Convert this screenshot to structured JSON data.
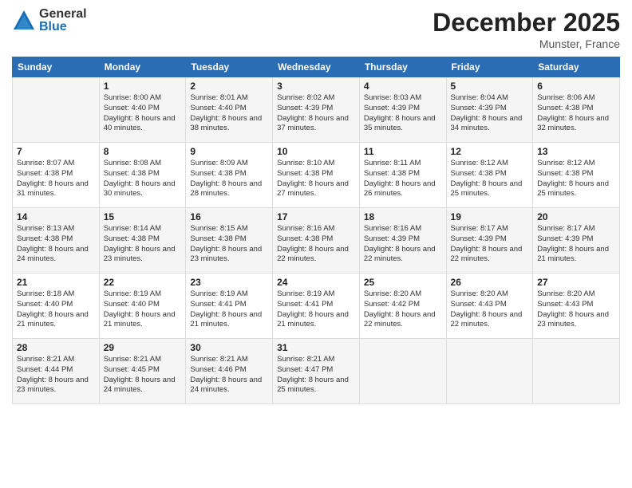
{
  "header": {
    "logo_general": "General",
    "logo_blue": "Blue",
    "month_title": "December 2025",
    "location": "Munster, France"
  },
  "weekdays": [
    "Sunday",
    "Monday",
    "Tuesday",
    "Wednesday",
    "Thursday",
    "Friday",
    "Saturday"
  ],
  "weeks": [
    [
      {
        "day": "",
        "sunrise": "",
        "sunset": "",
        "daylight": ""
      },
      {
        "day": "1",
        "sunrise": "Sunrise: 8:00 AM",
        "sunset": "Sunset: 4:40 PM",
        "daylight": "Daylight: 8 hours and 40 minutes."
      },
      {
        "day": "2",
        "sunrise": "Sunrise: 8:01 AM",
        "sunset": "Sunset: 4:40 PM",
        "daylight": "Daylight: 8 hours and 38 minutes."
      },
      {
        "day": "3",
        "sunrise": "Sunrise: 8:02 AM",
        "sunset": "Sunset: 4:39 PM",
        "daylight": "Daylight: 8 hours and 37 minutes."
      },
      {
        "day": "4",
        "sunrise": "Sunrise: 8:03 AM",
        "sunset": "Sunset: 4:39 PM",
        "daylight": "Daylight: 8 hours and 35 minutes."
      },
      {
        "day": "5",
        "sunrise": "Sunrise: 8:04 AM",
        "sunset": "Sunset: 4:39 PM",
        "daylight": "Daylight: 8 hours and 34 minutes."
      },
      {
        "day": "6",
        "sunrise": "Sunrise: 8:06 AM",
        "sunset": "Sunset: 4:38 PM",
        "daylight": "Daylight: 8 hours and 32 minutes."
      }
    ],
    [
      {
        "day": "7",
        "sunrise": "Sunrise: 8:07 AM",
        "sunset": "Sunset: 4:38 PM",
        "daylight": "Daylight: 8 hours and 31 minutes."
      },
      {
        "day": "8",
        "sunrise": "Sunrise: 8:08 AM",
        "sunset": "Sunset: 4:38 PM",
        "daylight": "Daylight: 8 hours and 30 minutes."
      },
      {
        "day": "9",
        "sunrise": "Sunrise: 8:09 AM",
        "sunset": "Sunset: 4:38 PM",
        "daylight": "Daylight: 8 hours and 28 minutes."
      },
      {
        "day": "10",
        "sunrise": "Sunrise: 8:10 AM",
        "sunset": "Sunset: 4:38 PM",
        "daylight": "Daylight: 8 hours and 27 minutes."
      },
      {
        "day": "11",
        "sunrise": "Sunrise: 8:11 AM",
        "sunset": "Sunset: 4:38 PM",
        "daylight": "Daylight: 8 hours and 26 minutes."
      },
      {
        "day": "12",
        "sunrise": "Sunrise: 8:12 AM",
        "sunset": "Sunset: 4:38 PM",
        "daylight": "Daylight: 8 hours and 25 minutes."
      },
      {
        "day": "13",
        "sunrise": "Sunrise: 8:12 AM",
        "sunset": "Sunset: 4:38 PM",
        "daylight": "Daylight: 8 hours and 25 minutes."
      }
    ],
    [
      {
        "day": "14",
        "sunrise": "Sunrise: 8:13 AM",
        "sunset": "Sunset: 4:38 PM",
        "daylight": "Daylight: 8 hours and 24 minutes."
      },
      {
        "day": "15",
        "sunrise": "Sunrise: 8:14 AM",
        "sunset": "Sunset: 4:38 PM",
        "daylight": "Daylight: 8 hours and 23 minutes."
      },
      {
        "day": "16",
        "sunrise": "Sunrise: 8:15 AM",
        "sunset": "Sunset: 4:38 PM",
        "daylight": "Daylight: 8 hours and 23 minutes."
      },
      {
        "day": "17",
        "sunrise": "Sunrise: 8:16 AM",
        "sunset": "Sunset: 4:38 PM",
        "daylight": "Daylight: 8 hours and 22 minutes."
      },
      {
        "day": "18",
        "sunrise": "Sunrise: 8:16 AM",
        "sunset": "Sunset: 4:39 PM",
        "daylight": "Daylight: 8 hours and 22 minutes."
      },
      {
        "day": "19",
        "sunrise": "Sunrise: 8:17 AM",
        "sunset": "Sunset: 4:39 PM",
        "daylight": "Daylight: 8 hours and 22 minutes."
      },
      {
        "day": "20",
        "sunrise": "Sunrise: 8:17 AM",
        "sunset": "Sunset: 4:39 PM",
        "daylight": "Daylight: 8 hours and 21 minutes."
      }
    ],
    [
      {
        "day": "21",
        "sunrise": "Sunrise: 8:18 AM",
        "sunset": "Sunset: 4:40 PM",
        "daylight": "Daylight: 8 hours and 21 minutes."
      },
      {
        "day": "22",
        "sunrise": "Sunrise: 8:19 AM",
        "sunset": "Sunset: 4:40 PM",
        "daylight": "Daylight: 8 hours and 21 minutes."
      },
      {
        "day": "23",
        "sunrise": "Sunrise: 8:19 AM",
        "sunset": "Sunset: 4:41 PM",
        "daylight": "Daylight: 8 hours and 21 minutes."
      },
      {
        "day": "24",
        "sunrise": "Sunrise: 8:19 AM",
        "sunset": "Sunset: 4:41 PM",
        "daylight": "Daylight: 8 hours and 21 minutes."
      },
      {
        "day": "25",
        "sunrise": "Sunrise: 8:20 AM",
        "sunset": "Sunset: 4:42 PM",
        "daylight": "Daylight: 8 hours and 22 minutes."
      },
      {
        "day": "26",
        "sunrise": "Sunrise: 8:20 AM",
        "sunset": "Sunset: 4:43 PM",
        "daylight": "Daylight: 8 hours and 22 minutes."
      },
      {
        "day": "27",
        "sunrise": "Sunrise: 8:20 AM",
        "sunset": "Sunset: 4:43 PM",
        "daylight": "Daylight: 8 hours and 23 minutes."
      }
    ],
    [
      {
        "day": "28",
        "sunrise": "Sunrise: 8:21 AM",
        "sunset": "Sunset: 4:44 PM",
        "daylight": "Daylight: 8 hours and 23 minutes."
      },
      {
        "day": "29",
        "sunrise": "Sunrise: 8:21 AM",
        "sunset": "Sunset: 4:45 PM",
        "daylight": "Daylight: 8 hours and 24 minutes."
      },
      {
        "day": "30",
        "sunrise": "Sunrise: 8:21 AM",
        "sunset": "Sunset: 4:46 PM",
        "daylight": "Daylight: 8 hours and 24 minutes."
      },
      {
        "day": "31",
        "sunrise": "Sunrise: 8:21 AM",
        "sunset": "Sunset: 4:47 PM",
        "daylight": "Daylight: 8 hours and 25 minutes."
      },
      {
        "day": "",
        "sunrise": "",
        "sunset": "",
        "daylight": ""
      },
      {
        "day": "",
        "sunrise": "",
        "sunset": "",
        "daylight": ""
      },
      {
        "day": "",
        "sunrise": "",
        "sunset": "",
        "daylight": ""
      }
    ]
  ]
}
